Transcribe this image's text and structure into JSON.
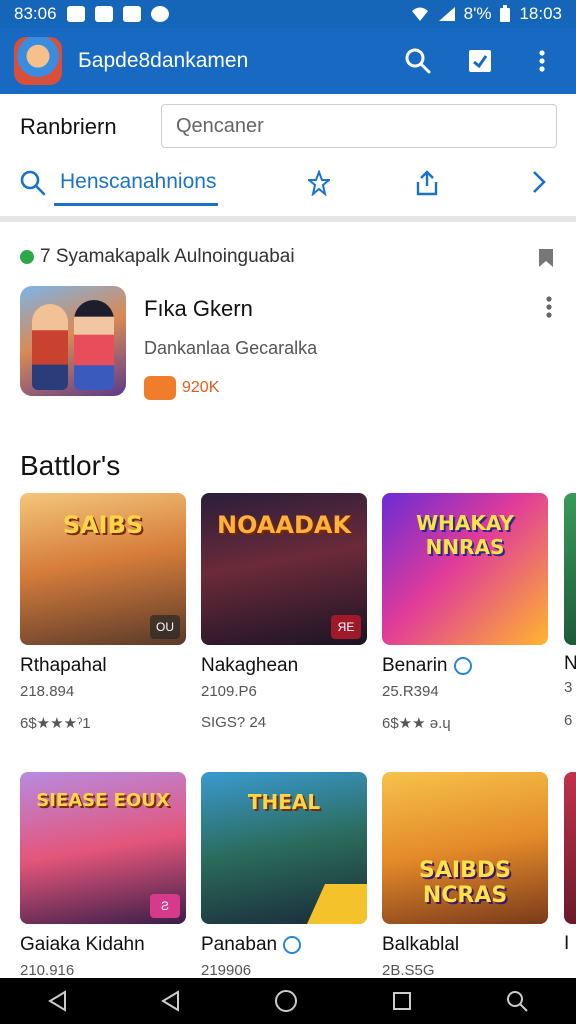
{
  "status_bar": {
    "time_left": "83:06",
    "battery": "8'%",
    "time_right": "18:03"
  },
  "app_bar": {
    "title": "Бapde8dankamen"
  },
  "subheader": {
    "title": "Ranbriern",
    "search_placeholder": "Qencaner",
    "tab_label": "Henscanahnions"
  },
  "featured": {
    "header": "7 Syamakapalk Aulnoinguabai",
    "title": "Fıka Gkern",
    "developer": "Dankanlaa Gecaralka",
    "price": "920K"
  },
  "section": {
    "title": "Battlor's"
  },
  "tiles_row1": [
    {
      "name": "Rthapahal",
      "size": "218.894",
      "rating": "6$★★★ˀ1",
      "thumb_text": "SAIBS",
      "badge": "OU",
      "verified": false
    },
    {
      "name": "Nakaghean",
      "size": "2109.P6",
      "rating": "SIGS? 24",
      "thumb_text": "NOAADAK",
      "badge": "ЯЕ",
      "verified": false
    },
    {
      "name": "Benarin",
      "size": "25.R394",
      "rating": "6$★★ ə.ɥ",
      "thumb_text": "WHAKAY NNRAS",
      "badge": "",
      "verified": true
    }
  ],
  "tiles_row2": [
    {
      "name": "Gaiaka Kidahn",
      "size": "210.916",
      "thumb_text": "SIEASE EOUX",
      "badge": "Ƨ",
      "verified": false
    },
    {
      "name": "Panaban",
      "size": "219906",
      "thumb_text": "THEAL",
      "badge": "",
      "verified": true
    },
    {
      "name": "Balkablal",
      "size": "2B.S5G",
      "thumb_text": "SAIBDS NCRAS",
      "badge": "",
      "verified": false
    }
  ],
  "edge_letters": {
    "row1_name": "N",
    "row1_size": "3",
    "row1_rating": "6",
    "row2_name": "I"
  },
  "colors": {
    "primary": "#1769c2",
    "accent": "#1a73c9",
    "price": "#e65a1e"
  }
}
